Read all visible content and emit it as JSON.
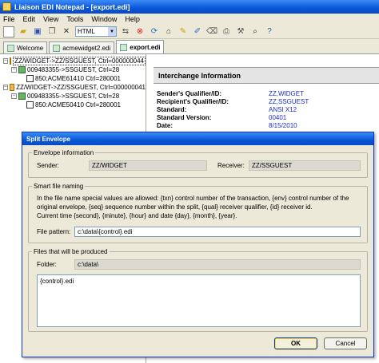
{
  "window": {
    "title": "Liaison EDI Notepad - [export.edi]"
  },
  "menu": [
    "File",
    "Edit",
    "View",
    "Tools",
    "Window",
    "Help"
  ],
  "toolbar": {
    "format_select": "HTML",
    "buttons": [
      "new-icon",
      "open-icon",
      "save-icon",
      "copy-icon",
      "cut-icon",
      "close-icon",
      "format-icon",
      "stop-icon",
      "refresh-icon",
      "home-icon",
      "pencil-icon",
      "edit-icon",
      "delete-icon",
      "print-icon",
      "tools-icon",
      "zoom-icon",
      "help-icon"
    ]
  },
  "tabs": [
    {
      "label": "Welcome",
      "active": false
    },
    {
      "label": "acmewidget2.edi",
      "active": false
    },
    {
      "label": "export.edi",
      "active": true
    }
  ],
  "tree": [
    {
      "level": 0,
      "exp": "−",
      "icon": "env",
      "label": "ZZ/WIDGET->ZZ/SSGUEST, Ctrl=000000044",
      "selected": true
    },
    {
      "level": 1,
      "exp": "−",
      "icon": "grp",
      "label": "009483355->SSGUEST, Ctrl=28",
      "selected": false
    },
    {
      "level": 2,
      "exp": "",
      "icon": "doc",
      "label": "850:ACME61410 Ctrl=280001",
      "selected": false
    },
    {
      "level": 0,
      "exp": "−",
      "icon": "env",
      "label": "ZZ/WIDGET->ZZ/SSGUEST, Ctrl=000000041",
      "selected": false
    },
    {
      "level": 1,
      "exp": "−",
      "icon": "grp",
      "label": "009483355->SSGUEST, Ctrl=28",
      "selected": false
    },
    {
      "level": 2,
      "exp": "",
      "icon": "doc",
      "label": "850:ACME50410 Ctrl=280001",
      "selected": false
    }
  ],
  "detail": {
    "header": "Interchange Information",
    "rows": [
      {
        "k": "Sender's Qualifier/ID:",
        "v": "ZZ,WIDGET"
      },
      {
        "k": "Recipient's Qualifier/ID:",
        "v": "ZZ,SSGUEST"
      },
      {
        "k": "Standard:",
        "v": "ANSI X12"
      },
      {
        "k": "Standard Version:",
        "v": "00401"
      },
      {
        "k": "Date:",
        "v": "8/15/2010"
      }
    ]
  },
  "dialog": {
    "title": "Split Envelope",
    "envelope": {
      "title": "Envelope information",
      "sender_label": "Sender:",
      "sender_value": "ZZ/WIDGET",
      "receiver_label": "Receiver:",
      "receiver_value": "ZZ/SSGUEST"
    },
    "naming": {
      "title": "Smart file naming",
      "help_1": "In the file name special values are allowed: {txn} control number of the transaction, {env} control number of the",
      "help_2": "original envelope, {seq} sequence number within the split, {qual} receiver qualifier, {id} receiver id.",
      "help_3": "Current time {second}, {minute}, {hour} and date {day}, {month}, {year}.",
      "pattern_label": "File pattern:",
      "pattern_value": "c:\\data\\{control}.edi"
    },
    "produced": {
      "title": "Files that will be produced",
      "folder_label": "Folder:",
      "folder_value": "c:\\data\\",
      "files": "{control}.edi"
    },
    "ok_label": "OK",
    "cancel_label": "Cancel"
  }
}
